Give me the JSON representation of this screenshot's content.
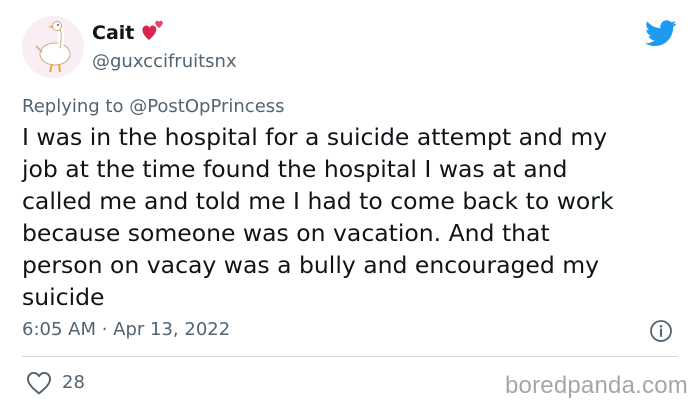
{
  "author": {
    "display_name": "Cait",
    "handle": "@guxccifruitsnx",
    "avatar_icon": "goose-avatar-icon",
    "badge_icon": "two-hearts-icon"
  },
  "reply": {
    "prefix": "Replying to ",
    "mention": "@PostOpPrincess"
  },
  "tweet": {
    "lines": [
      "I was in the hospital for a suicide attempt and my",
      "job at the time found the hospital I was at and",
      "called me and told me I had to come back to work",
      "because someone was on vacation. And that",
      "person on vacay was a bully and encouraged my",
      "suicide"
    ]
  },
  "meta": {
    "timestamp": "6:05 AM · Apr 13, 2022",
    "info_icon": "info-icon"
  },
  "actions": {
    "like_count": "28",
    "like_icon": "heart-outline-icon"
  },
  "brand": {
    "platform_icon": "twitter-bird-icon",
    "platform_color": "#1d9bf0",
    "watermark": "boredpanda.com"
  },
  "colors": {
    "text": "#0f1419",
    "secondary": "#536471",
    "divider": "#cfd9de"
  }
}
